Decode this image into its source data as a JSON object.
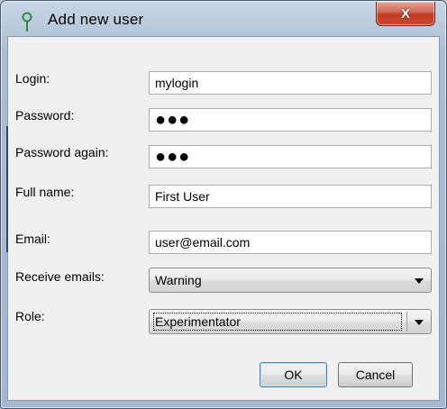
{
  "window": {
    "title": "Add new user",
    "close_label": "X",
    "app_icon": "pin-icon"
  },
  "form": {
    "login": {
      "label": "Login:",
      "value": "mylogin"
    },
    "password": {
      "label": "Password:",
      "value": "●●●"
    },
    "password_again": {
      "label": "Password again:",
      "value": "●●●"
    },
    "full_name": {
      "label": "Full name:",
      "value": "First User"
    },
    "email": {
      "label": "Email:",
      "value": "user@email.com"
    },
    "receive_emails": {
      "label": "Receive emails:",
      "value": "Warning"
    },
    "role": {
      "label": "Role:",
      "value": "Experimentator"
    }
  },
  "buttons": {
    "ok": "OK",
    "cancel": "Cancel"
  },
  "colors": {
    "close_button": "#c94a2f",
    "window_frame": "#b8cadc",
    "client_bg": "#f0f0f0"
  }
}
